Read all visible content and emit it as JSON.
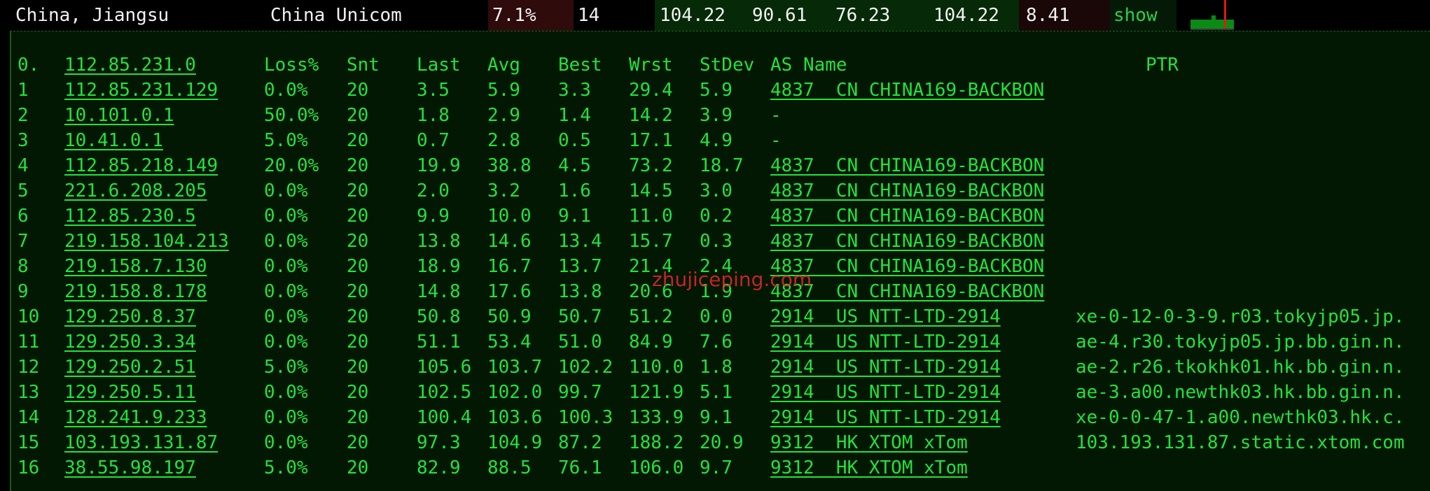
{
  "summary": {
    "location": "China, Jiangsu",
    "isp": "China Unicom",
    "loss": "7.1%",
    "sent": "14",
    "last": "104.22",
    "best": "90.61",
    "avg": "76.23",
    "worst": "104.22",
    "stdev": "8.41",
    "show_label": "show",
    "sparkline_icon": "latency-sparkline-icon"
  },
  "colors": {
    "terminal_text": "#22e23a",
    "terminal_bg": "#031803",
    "loss_cell_bg": "#2f0b0b",
    "latency_cell_bg": "#062a08",
    "watermark": "#e62828"
  },
  "table": {
    "headers": {
      "hop": "0.",
      "host": "112.85.231.0",
      "loss": "Loss%",
      "snt": "Snt",
      "last": "Last",
      "avg": "Avg",
      "best": "Best",
      "wrst": "Wrst",
      "stdev": "StDev",
      "as": "AS Name",
      "ptr": "PTR"
    },
    "rows": [
      {
        "hop": "1",
        "host": "112.85.231.129",
        "loss": "0.0%",
        "snt": "20",
        "last": "3.5",
        "avg": "5.9",
        "best": "3.3",
        "wrst": "29.4",
        "stdev": "5.9",
        "as": "4837  CN CHINA169-BACKBON",
        "ptr": ""
      },
      {
        "hop": "2",
        "host": "10.101.0.1",
        "loss": "50.0%",
        "snt": "20",
        "last": "1.8",
        "avg": "2.9",
        "best": "1.4",
        "wrst": "14.2",
        "stdev": "3.9",
        "as": "-",
        "ptr": ""
      },
      {
        "hop": "3",
        "host": "10.41.0.1",
        "loss": "5.0%",
        "snt": "20",
        "last": "0.7",
        "avg": "2.8",
        "best": "0.5",
        "wrst": "17.1",
        "stdev": "4.9",
        "as": "-",
        "ptr": ""
      },
      {
        "hop": "4",
        "host": "112.85.218.149",
        "loss": "20.0%",
        "snt": "20",
        "last": "19.9",
        "avg": "38.8",
        "best": "4.5",
        "wrst": "73.2",
        "stdev": "18.7",
        "as": "4837  CN CHINA169-BACKBON",
        "ptr": ""
      },
      {
        "hop": "5",
        "host": "221.6.208.205",
        "loss": "0.0%",
        "snt": "20",
        "last": "2.0",
        "avg": "3.2",
        "best": "1.6",
        "wrst": "14.5",
        "stdev": "3.0",
        "as": "4837  CN CHINA169-BACKBON",
        "ptr": ""
      },
      {
        "hop": "6",
        "host": "112.85.230.5",
        "loss": "0.0%",
        "snt": "20",
        "last": "9.9",
        "avg": "10.0",
        "best": "9.1",
        "wrst": "11.0",
        "stdev": "0.2",
        "as": "4837  CN CHINA169-BACKBON",
        "ptr": ""
      },
      {
        "hop": "7",
        "host": "219.158.104.213",
        "loss": "0.0%",
        "snt": "20",
        "last": "13.8",
        "avg": "14.6",
        "best": "13.4",
        "wrst": "15.7",
        "stdev": "0.3",
        "as": "4837  CN CHINA169-BACKBON",
        "ptr": ""
      },
      {
        "hop": "8",
        "host": "219.158.7.130",
        "loss": "0.0%",
        "snt": "20",
        "last": "18.9",
        "avg": "16.7",
        "best": "13.7",
        "wrst": "21.4",
        "stdev": "2.4",
        "as": "4837  CN CHINA169-BACKBON",
        "ptr": ""
      },
      {
        "hop": "9",
        "host": "219.158.8.178",
        "loss": "0.0%",
        "snt": "20",
        "last": "14.8",
        "avg": "17.6",
        "best": "13.8",
        "wrst": "20.6",
        "stdev": "1.9",
        "as": "4837  CN CHINA169-BACKBON",
        "ptr": ""
      },
      {
        "hop": "10",
        "host": "129.250.8.37",
        "loss": "0.0%",
        "snt": "20",
        "last": "50.8",
        "avg": "50.9",
        "best": "50.7",
        "wrst": "51.2",
        "stdev": "0.0",
        "as": "2914  US NTT-LTD-2914",
        "ptr": "xe-0-12-0-3-9.r03.tokyjp05.jp."
      },
      {
        "hop": "11",
        "host": "129.250.3.34",
        "loss": "0.0%",
        "snt": "20",
        "last": "51.1",
        "avg": "53.4",
        "best": "51.0",
        "wrst": "84.9",
        "stdev": "7.6",
        "as": "2914  US NTT-LTD-2914",
        "ptr": "ae-4.r30.tokyjp05.jp.bb.gin.n."
      },
      {
        "hop": "12",
        "host": "129.250.2.51",
        "loss": "5.0%",
        "snt": "20",
        "last": "105.6",
        "avg": "103.7",
        "best": "102.2",
        "wrst": "110.0",
        "stdev": "1.8",
        "as": "2914  US NTT-LTD-2914",
        "ptr": "ae-2.r26.tkokhk01.hk.bb.gin.n."
      },
      {
        "hop": "13",
        "host": "129.250.5.11",
        "loss": "0.0%",
        "snt": "20",
        "last": "102.5",
        "avg": "102.0",
        "best": "99.7",
        "wrst": "121.9",
        "stdev": "5.1",
        "as": "2914  US NTT-LTD-2914",
        "ptr": "ae-3.a00.newthk03.hk.bb.gin.n."
      },
      {
        "hop": "14",
        "host": "128.241.9.233",
        "loss": "0.0%",
        "snt": "20",
        "last": "100.4",
        "avg": "103.6",
        "best": "100.3",
        "wrst": "133.9",
        "stdev": "9.1",
        "as": "2914  US NTT-LTD-2914",
        "ptr": "xe-0-0-47-1.a00.newthk03.hk.c."
      },
      {
        "hop": "15",
        "host": "103.193.131.87",
        "loss": "0.0%",
        "snt": "20",
        "last": "97.3",
        "avg": "104.9",
        "best": "87.2",
        "wrst": "188.2",
        "stdev": "20.9",
        "as": "9312  HK XTOM xTom",
        "ptr": "103.193.131.87.static.xtom.com"
      },
      {
        "hop": "16",
        "host": "38.55.98.197",
        "loss": "5.0%",
        "snt": "20",
        "last": "82.9",
        "avg": "88.5",
        "best": "76.1",
        "wrst": "106.0",
        "stdev": "9.7",
        "as": "9312  HK XTOM xTom",
        "ptr": ""
      }
    ]
  },
  "watermark": "zhujiceping.com"
}
